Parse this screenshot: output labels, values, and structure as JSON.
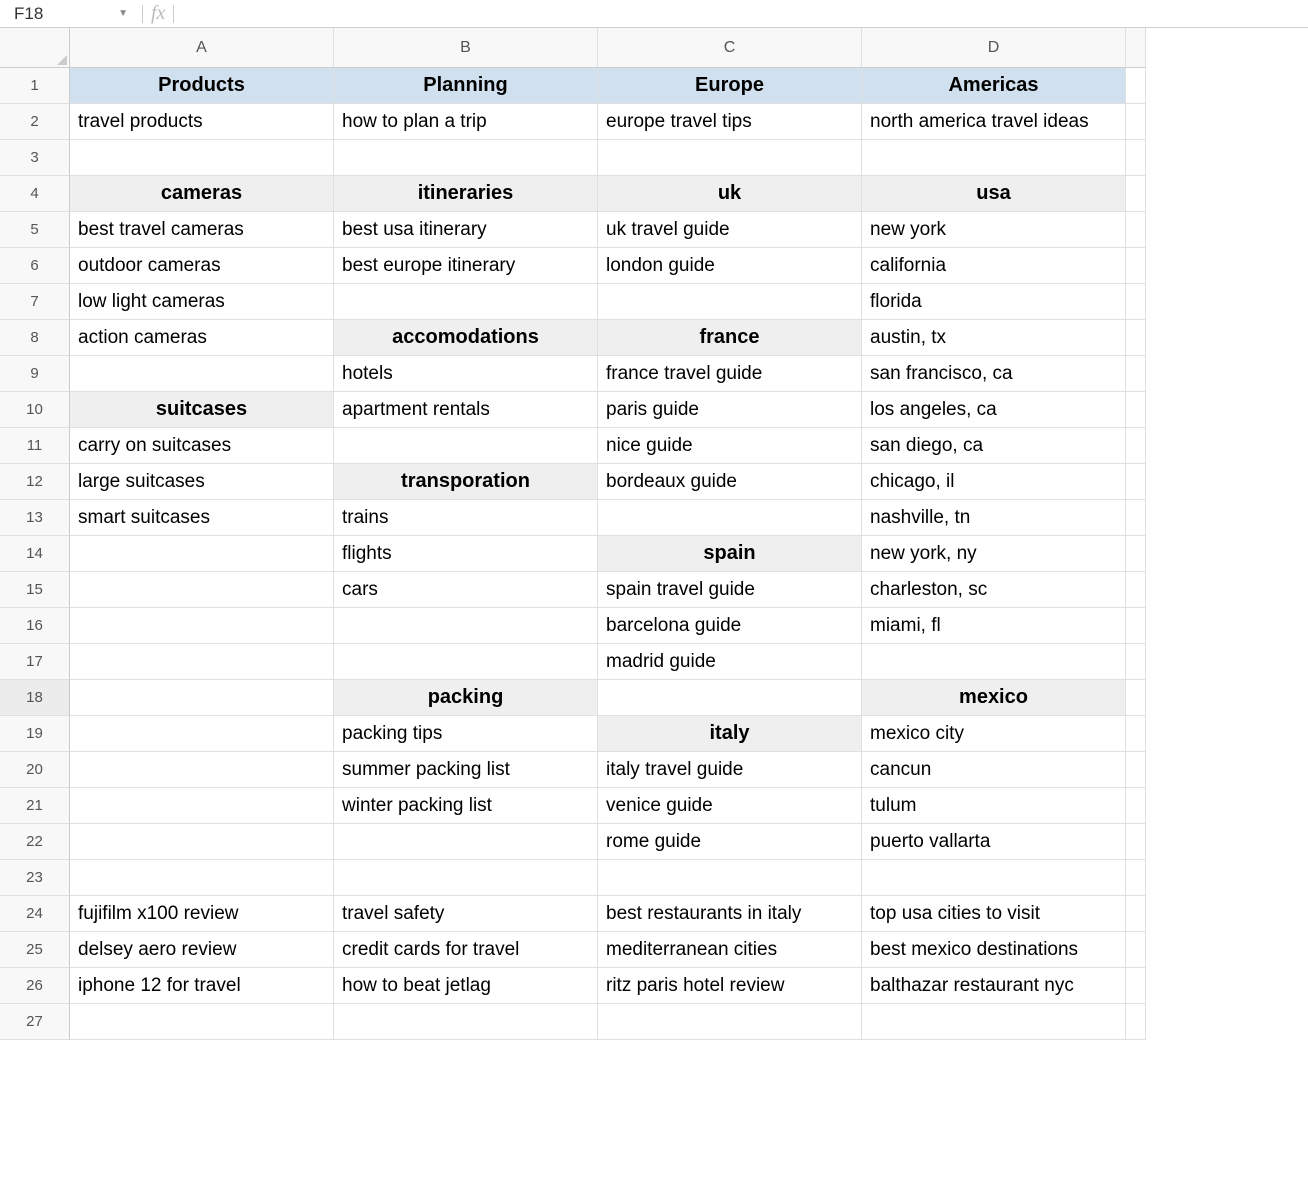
{
  "name_box": "F18",
  "fx_label": "fx",
  "columns": [
    "A",
    "B",
    "C",
    "D"
  ],
  "row_count": 27,
  "selected_row": 18,
  "cells": {
    "r1": {
      "A": {
        "text": "Products",
        "style": "header-blue"
      },
      "B": {
        "text": "Planning",
        "style": "header-blue"
      },
      "C": {
        "text": "Europe",
        "style": "header-blue"
      },
      "D": {
        "text": "Americas",
        "style": "header-blue"
      }
    },
    "r2": {
      "A": {
        "text": "travel products"
      },
      "B": {
        "text": "how to plan a trip"
      },
      "C": {
        "text": "europe travel tips"
      },
      "D": {
        "text": "north america travel ideas"
      }
    },
    "r3": {},
    "r4": {
      "A": {
        "text": "cameras",
        "style": "header-gray"
      },
      "B": {
        "text": "itineraries",
        "style": "header-gray"
      },
      "C": {
        "text": "uk",
        "style": "header-gray"
      },
      "D": {
        "text": "usa",
        "style": "header-gray"
      }
    },
    "r5": {
      "A": {
        "text": "best travel cameras"
      },
      "B": {
        "text": "best usa itinerary"
      },
      "C": {
        "text": "uk travel guide"
      },
      "D": {
        "text": "new york"
      }
    },
    "r6": {
      "A": {
        "text": "outdoor cameras"
      },
      "B": {
        "text": "best europe itinerary"
      },
      "C": {
        "text": "london guide"
      },
      "D": {
        "text": "california"
      }
    },
    "r7": {
      "A": {
        "text": "low light cameras"
      },
      "D": {
        "text": "florida"
      }
    },
    "r8": {
      "A": {
        "text": "action cameras"
      },
      "B": {
        "text": "accomodations",
        "style": "header-gray"
      },
      "C": {
        "text": "france",
        "style": "header-gray"
      },
      "D": {
        "text": "austin, tx"
      }
    },
    "r9": {
      "B": {
        "text": "hotels"
      },
      "C": {
        "text": "france travel guide"
      },
      "D": {
        "text": "san francisco, ca"
      }
    },
    "r10": {
      "A": {
        "text": "suitcases",
        "style": "header-gray"
      },
      "B": {
        "text": "apartment rentals"
      },
      "C": {
        "text": "paris guide"
      },
      "D": {
        "text": "los angeles, ca"
      }
    },
    "r11": {
      "A": {
        "text": "carry on suitcases"
      },
      "C": {
        "text": "nice guide"
      },
      "D": {
        "text": "san diego, ca"
      }
    },
    "r12": {
      "A": {
        "text": "large suitcases"
      },
      "B": {
        "text": "transporation",
        "style": "header-gray"
      },
      "C": {
        "text": "bordeaux guide"
      },
      "D": {
        "text": "chicago, il"
      }
    },
    "r13": {
      "A": {
        "text": "smart suitcases"
      },
      "B": {
        "text": "trains"
      },
      "D": {
        "text": "nashville, tn"
      }
    },
    "r14": {
      "B": {
        "text": "flights"
      },
      "C": {
        "text": "spain",
        "style": "header-gray"
      },
      "D": {
        "text": "new york, ny"
      }
    },
    "r15": {
      "B": {
        "text": "cars"
      },
      "C": {
        "text": "spain travel guide"
      },
      "D": {
        "text": "charleston, sc"
      }
    },
    "r16": {
      "C": {
        "text": "barcelona guide"
      },
      "D": {
        "text": "miami, fl"
      }
    },
    "r17": {
      "C": {
        "text": "madrid guide"
      }
    },
    "r18": {
      "B": {
        "text": "packing",
        "style": "header-gray"
      },
      "D": {
        "text": "mexico",
        "style": "header-gray"
      }
    },
    "r19": {
      "B": {
        "text": "packing tips"
      },
      "C": {
        "text": "italy",
        "style": "header-gray"
      },
      "D": {
        "text": "mexico city"
      }
    },
    "r20": {
      "B": {
        "text": "summer packing list"
      },
      "C": {
        "text": "italy travel guide"
      },
      "D": {
        "text": "cancun"
      }
    },
    "r21": {
      "B": {
        "text": "winter packing list"
      },
      "C": {
        "text": "venice guide"
      },
      "D": {
        "text": "tulum"
      }
    },
    "r22": {
      "C": {
        "text": "rome guide"
      },
      "D": {
        "text": "puerto vallarta"
      }
    },
    "r23": {},
    "r24": {
      "A": {
        "text": "fujifilm x100 review"
      },
      "B": {
        "text": "travel safety"
      },
      "C": {
        "text": "best restaurants in italy"
      },
      "D": {
        "text": "top usa cities to visit"
      }
    },
    "r25": {
      "A": {
        "text": "delsey aero review"
      },
      "B": {
        "text": "credit cards for travel"
      },
      "C": {
        "text": "mediterranean cities"
      },
      "D": {
        "text": "best mexico destinations"
      }
    },
    "r26": {
      "A": {
        "text": "iphone 12 for travel"
      },
      "B": {
        "text": "how to beat jetlag"
      },
      "C": {
        "text": "ritz paris hotel review"
      },
      "D": {
        "text": "balthazar restaurant nyc"
      }
    },
    "r27": {}
  }
}
